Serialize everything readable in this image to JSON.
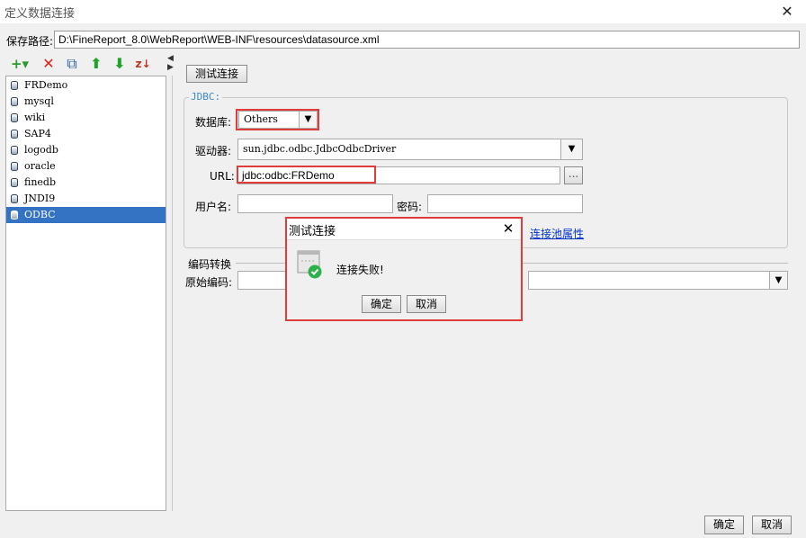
{
  "window": {
    "title": "定义数据连接",
    "close_glyph": "✕"
  },
  "save_path": {
    "label": "保存路径:",
    "value": "D:\\FineReport_8.0\\WebReport\\WEB-INF\\resources\\datasource.xml"
  },
  "toolbar": {
    "add_glyph": "+▾",
    "delete_glyph": "✕",
    "copy_glyph": "⧉",
    "up_glyph": "⬆",
    "down_glyph": "⬇",
    "sort_glyph": "z↓"
  },
  "connections": [
    {
      "name": "FRDemo"
    },
    {
      "name": "mysql"
    },
    {
      "name": "wiki"
    },
    {
      "name": "SAP4"
    },
    {
      "name": "logodb"
    },
    {
      "name": "oracle"
    },
    {
      "name": "finedb"
    },
    {
      "name": "JNDI9"
    },
    {
      "name": "ODBC",
      "selected": true
    }
  ],
  "test_button": "测试连接",
  "jdbc": {
    "group_label": "JDBC:",
    "database_label": "数据库:",
    "database_value": "Others",
    "driver_label": "驱动器:",
    "driver_value": "sun.jdbc.odbc.JdbcOdbcDriver",
    "url_label": "URL:",
    "url_value": "jdbc:odbc:FRDemo",
    "url_browse": "...",
    "user_label": "用户名:",
    "user_value": "",
    "password_label": "密码:",
    "password_value": "",
    "pool_link": "连接池属性"
  },
  "encoding": {
    "section_label": "编码转换",
    "original_label": "原始编码:",
    "original_value": ""
  },
  "dialog": {
    "title": "测试连接",
    "close_glyph": "✕",
    "message": "连接失败!",
    "ok": "确定",
    "cancel": "取消"
  },
  "footer": {
    "ok": "确定",
    "cancel": "取消"
  },
  "colors": {
    "highlight": "#e03c3c",
    "selection": "#3472c4",
    "success": "#2fb14a",
    "link": "#0033cc"
  }
}
